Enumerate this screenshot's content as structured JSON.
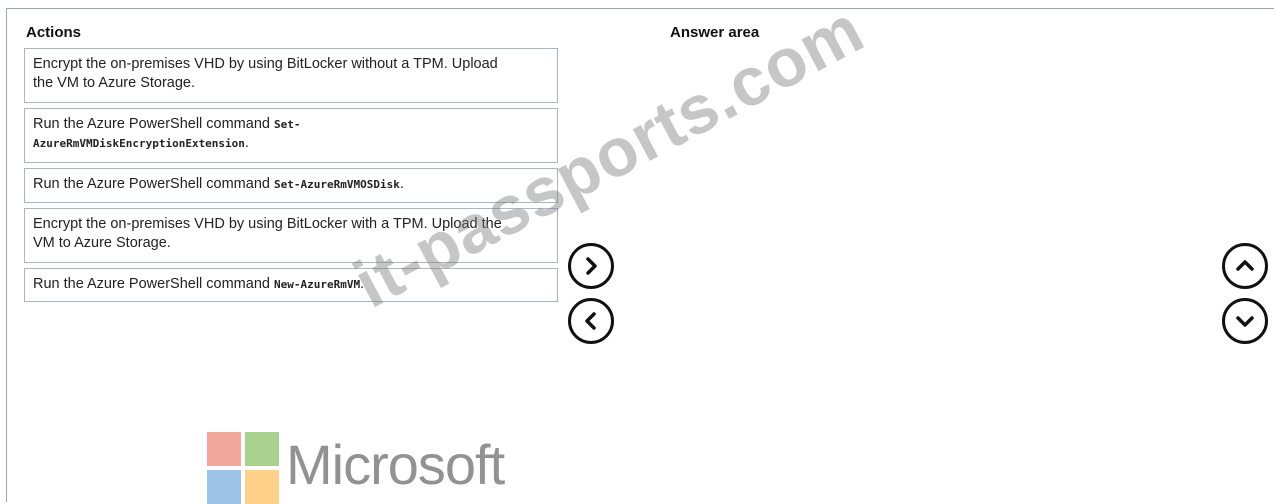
{
  "actions_heading": "Actions",
  "answer_heading": "Answer area",
  "actions": [
    {
      "line1": "Encrypt the on-premises VHD by using BitLocker without a TPM. Upload",
      "line2": "the VM to Azure Storage.",
      "cmd_a": "",
      "cmd_b": "",
      "tail": ""
    },
    {
      "line1": "Run the Azure PowerShell command ",
      "cmd_a": "Set-",
      "line2": "",
      "cmd_b": "AzureRmVMDiskEncryptionExtension",
      "tail": "."
    },
    {
      "line1": "Run the Azure PowerShell command ",
      "cmd_a": "Set-AzureRmVMOSDisk",
      "line2": "",
      "cmd_b": "",
      "tail": "."
    },
    {
      "line1": "Encrypt the on-premises VHD by using BitLocker with a TPM. Upload the",
      "line2": "VM to Azure Storage.",
      "cmd_a": "",
      "cmd_b": "",
      "tail": ""
    },
    {
      "line1": "Run the Azure PowerShell command ",
      "cmd_a": "New-AzureRmVM",
      "line2": "",
      "cmd_b": "",
      "tail": "."
    }
  ],
  "buttons": {
    "move_right": "chevron-right-icon",
    "move_left": "chevron-left-icon",
    "move_up": "chevron-up-icon",
    "move_down": "chevron-down-icon"
  },
  "watermark": "it-passports.com",
  "logo": {
    "text": "Microsoft",
    "colors": [
      "#f1a89a",
      "#a9d08e",
      "#9dc3e6",
      "#ffd18a"
    ]
  }
}
